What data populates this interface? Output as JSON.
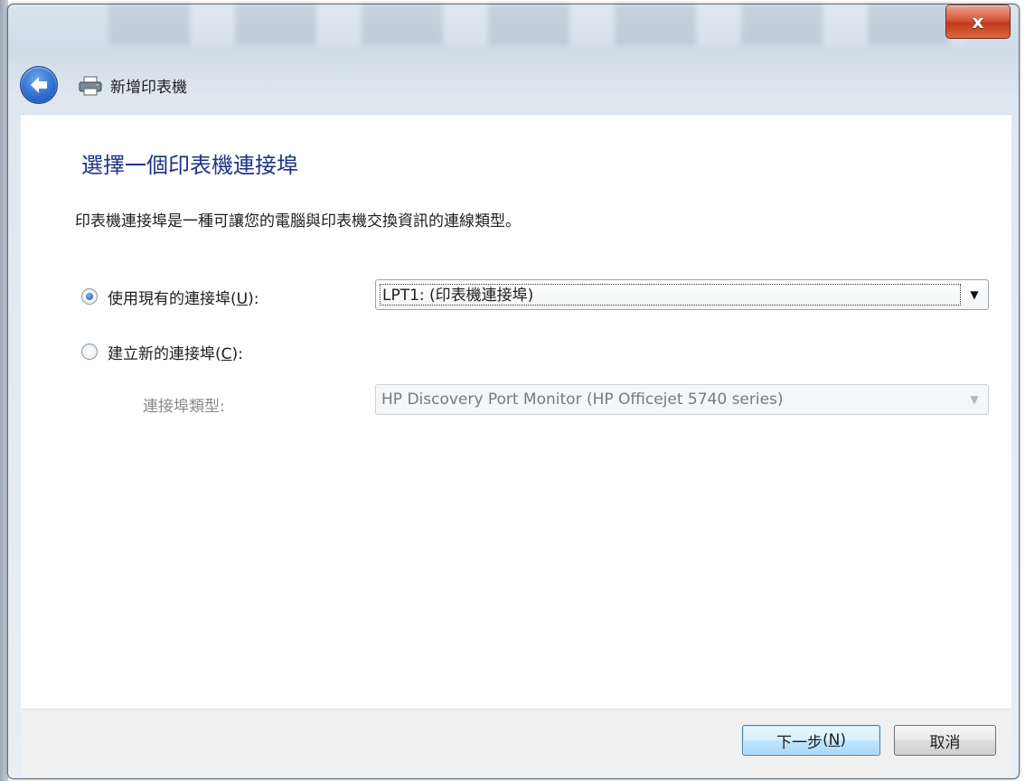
{
  "window": {
    "title": "新增印表機",
    "close_label": "x"
  },
  "page": {
    "heading": "選擇一個印表機連接埠",
    "description": "印表機連接埠是一種可讓您的電腦與印表機交換資訊的連線類型。"
  },
  "options": {
    "use_existing": {
      "label": "使用現有的連接埠",
      "accel_open": "(",
      "accel_key": "U",
      "accel_close": "):",
      "checked": true,
      "selected_value": "LPT1: (印表機連接埠)"
    },
    "create_new": {
      "label": "建立新的連接埠",
      "accel_open": "(",
      "accel_key": "C",
      "accel_close": "):",
      "checked": false,
      "type_label": "連接埠類型:",
      "type_value": "HP Discovery Port Monitor (HP Officejet 5740 series)"
    }
  },
  "footer": {
    "next_label": "下一步",
    "next_accel_open": "(",
    "next_accel_key": "N",
    "next_accel_close": ")",
    "cancel_label": "取消"
  },
  "icons": {
    "back": "back-arrow-icon",
    "printer": "printer-icon",
    "dropdown": "chevron-down-icon"
  },
  "colors": {
    "heading": "#1e3287",
    "close_button": "#d7573a",
    "primary_button": "#bee6fd"
  }
}
